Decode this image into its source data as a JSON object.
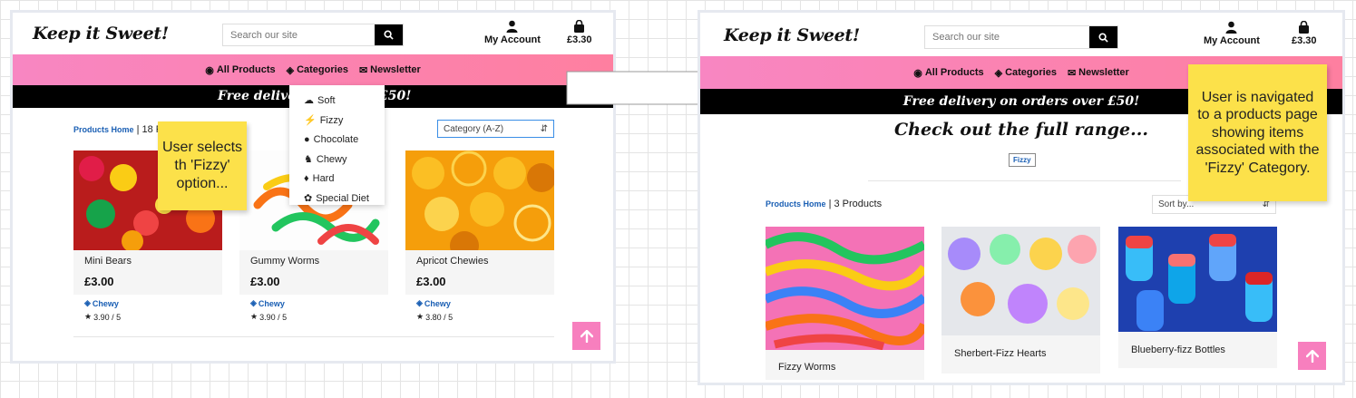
{
  "brand": "Keep it Sweet!",
  "search_placeholder": "Search our site",
  "account_label": "My Account",
  "basket_total": "£3.30",
  "nav": {
    "all_products": "All Products",
    "categories": "Categories",
    "newsletter": "Newsletter"
  },
  "banner_left": "Free delivery",
  "banner_left_tail": "£50!",
  "banner_full": "Free delivery on orders over £50!",
  "category_menu": [
    "Soft",
    "Fizzy",
    "Chocolate",
    "Chewy",
    "Hard",
    "Special Diet"
  ],
  "left": {
    "crumb_link": "Products Home",
    "crumb_count": "18 P",
    "sort_value": "Category (A-Z)",
    "products": [
      {
        "name": "Mini Bears",
        "price": "£3.00",
        "category": "Chewy",
        "rating": "3.90 / 5"
      },
      {
        "name": "Gummy Worms",
        "price": "£3.00",
        "category": "Chewy",
        "rating": "3.90 / 5"
      },
      {
        "name": "Apricot Chewies",
        "price": "£3.00",
        "category": "Chewy",
        "rating": "3.80 / 5"
      }
    ]
  },
  "right": {
    "range_title": "Check out the full range...",
    "category_chip": "Fizzy",
    "crumb_link": "Products Home",
    "crumb_count": "3 Products",
    "sort_value": "Sort by...",
    "products": [
      {
        "name": "Fizzy Worms"
      },
      {
        "name": "Sherbert-Fizz Hearts"
      },
      {
        "name": "Blueberry-fizz Bottles"
      }
    ]
  },
  "annotations": {
    "left_note": "User selects th 'Fizzy' option...",
    "right_note": "User is navigated to a products page showing items associated with the 'Fizzy' Category."
  },
  "colors": {
    "nav_pink": "#f886c2",
    "note_yellow": "#fce14a",
    "link_blue": "#1a5fb4",
    "totop_pink": "#f77fbe"
  }
}
